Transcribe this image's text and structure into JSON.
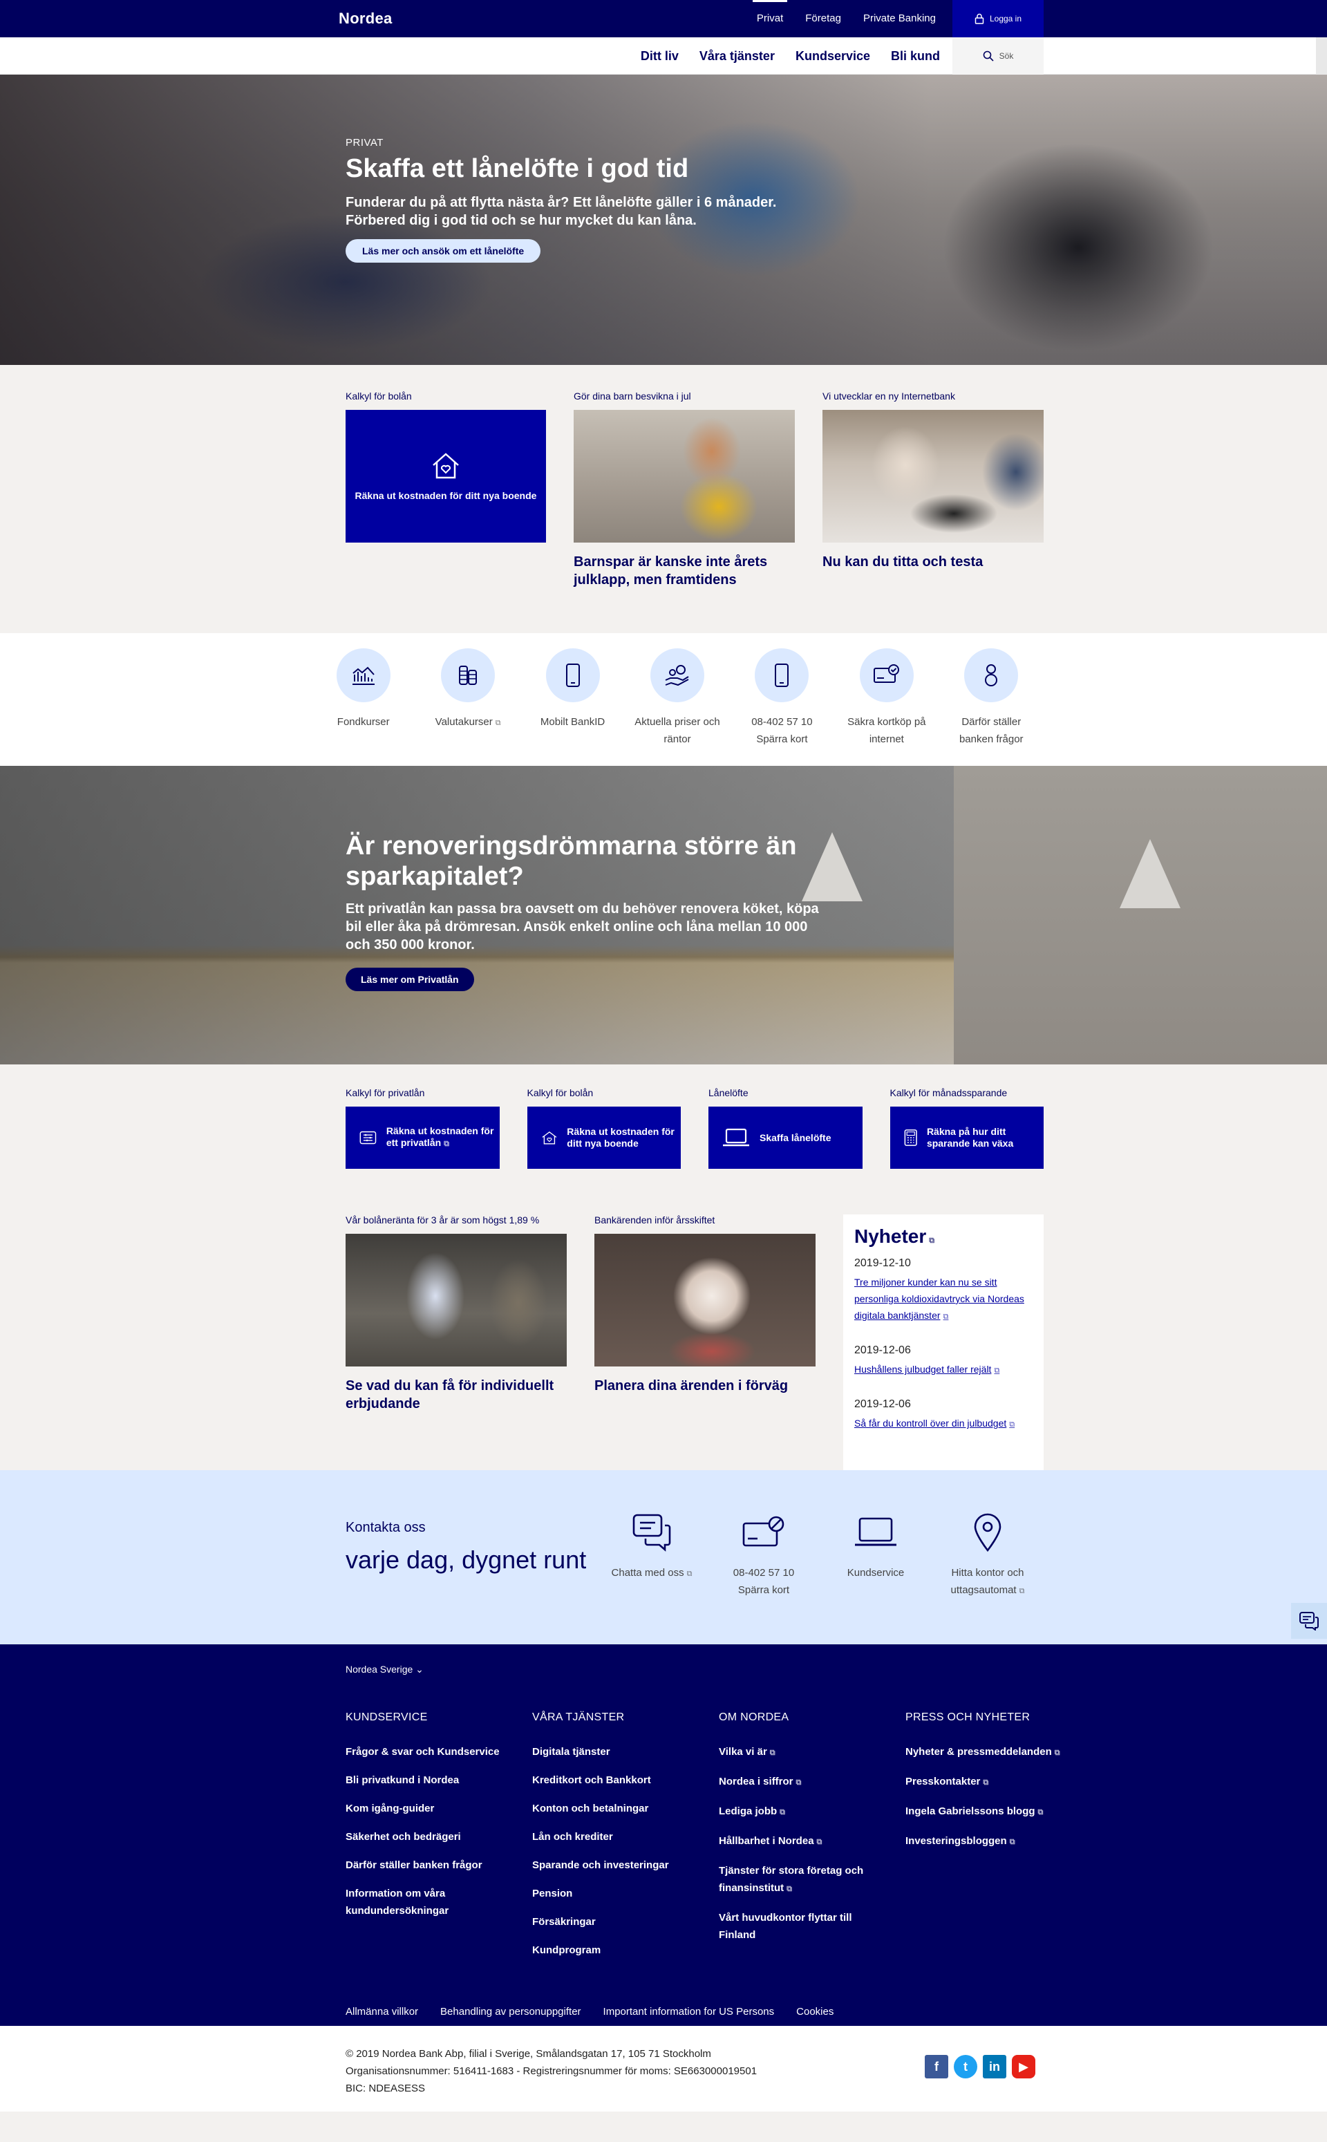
{
  "brand": "Nordea",
  "topnav": [
    "Privat",
    "Företag",
    "Private Banking"
  ],
  "login_label": "Logga in",
  "subnav": [
    "Ditt liv",
    "Våra tjänster",
    "Kundservice",
    "Bli kund"
  ],
  "search_label": "Sök",
  "hero": {
    "eyebrow": "PRIVAT",
    "title": "Skaffa ett lånelöfte i god tid",
    "text": "Funderar du på att flytta nästa år? Ett lånelöfte gäller i 6 månader. Förbered dig i god tid och se hur mycket du kan låna.",
    "button": "Läs mer och ansök om ett lånelöfte"
  },
  "cards": [
    {
      "label": "Kalkyl för bolån",
      "box_text": "Räkna ut kostnaden för ditt nya boende",
      "title": ""
    },
    {
      "label": "Gör dina barn besvikna i jul",
      "title": "Barnspar är kanske inte årets julklapp, men framtidens"
    },
    {
      "label": "Vi utvecklar en ny Internetbank",
      "title": "Nu kan du titta och testa"
    }
  ],
  "quicklinks": [
    {
      "label": "Fondkurser",
      "icon": "chart-icon"
    },
    {
      "label": "Valutakurser",
      "icon": "coins-icon"
    },
    {
      "label": "Mobilt BankID",
      "icon": "mobile-icon"
    },
    {
      "label": "Aktuella priser och räntor",
      "icon": "hand-coins-icon"
    },
    {
      "label": "08-402 57 10 Spärra kort",
      "icon": "phone-icon"
    },
    {
      "label": "Säkra kortköp på internet",
      "icon": "card-check-icon"
    },
    {
      "label": "Därför ställer banken frågor",
      "icon": "person-icon"
    }
  ],
  "reno": {
    "title": "Är renoveringsdrömmarna större än sparkapitalet?",
    "text": "Ett privatlån kan passa bra oavsett om du behöver renovera köket, köpa bil eller åka på drömresan. Ansök enkelt online och låna mellan 10 000 och 350 000 kronor.",
    "button": "Läs mer om Privatlån"
  },
  "calcs": [
    {
      "label": "Kalkyl för privatlån",
      "text": "Räkna ut kostnaden för ett privatlån"
    },
    {
      "label": "Kalkyl för bolån",
      "text": "Räkna ut kostnaden för ditt nya boende"
    },
    {
      "label": "Lånelöfte",
      "text": "Skaffa lånelöfte"
    },
    {
      "label": "Kalkyl för månadssparande",
      "text": "Räkna på hur ditt sparande kan växa"
    }
  ],
  "promos": [
    {
      "label": "Vår bolåneränta för 3 år är som högst 1,89 %",
      "title": "Se vad du kan få för individuellt erbjudande"
    },
    {
      "label": "Bankärenden inför årsskiftet",
      "title": "Planera dina ärenden i förväg"
    }
  ],
  "news": {
    "title": "Nyheter",
    "items": [
      {
        "date": "2019-12-10",
        "text": "Tre miljoner kunder kan nu se sitt personliga koldioxidavtryck via Nordeas digitala banktjänster"
      },
      {
        "date": "2019-12-06",
        "text": "Hushållens julbudget faller rejält"
      },
      {
        "date": "2019-12-06",
        "text": "Så får du kontroll över din julbudget"
      }
    ]
  },
  "contact": {
    "small": "Kontakta oss",
    "big": "varje dag, dygnet runt",
    "items": [
      {
        "label": "Chatta med oss",
        "icon": "chat-icon"
      },
      {
        "label": "08-402 57 10 Spärra kort",
        "icon": "card-block-icon"
      },
      {
        "label": "Kundservice",
        "icon": "laptop-icon"
      },
      {
        "label": "Hitta kontor och uttagsautomat",
        "icon": "location-pin-icon"
      }
    ]
  },
  "footer": {
    "region": "Nordea Sverige",
    "cols": [
      {
        "title": "KUNDSERVICE",
        "links": [
          "Frågor & svar och Kundservice",
          "Bli privatkund i Nordea",
          "Kom igång-guider",
          "Säkerhet och bedrägeri",
          "Därför ställer banken frågor",
          "Information om våra kundundersökningar"
        ]
      },
      {
        "title": "VÅRA TJÄNSTER",
        "links": [
          "Digitala tjänster",
          "Kreditkort och Bankkort",
          "Konton och betalningar",
          "Lån och krediter",
          "Sparande och investeringar",
          "Pension",
          "Försäkringar",
          "Kundprogram"
        ]
      },
      {
        "title": "OM NORDEA",
        "links": [
          "Vilka vi är",
          "Nordea i siffror",
          "Lediga jobb",
          "Hållbarhet i Nordea",
          "Tjänster för stora företag och finansinstitut",
          "Vårt huvudkontor flyttar till Finland"
        ]
      },
      {
        "title": "PRESS OCH NYHETER",
        "links": [
          "Nyheter & pressmeddelanden",
          "Presskontakter",
          "Ingela Gabrielssons blogg",
          "Investeringsbloggen"
        ]
      }
    ],
    "legal": [
      "Allmänna villkor",
      "Behandling av personuppgifter",
      "Important information for US Persons",
      "Cookies"
    ]
  },
  "copyright": {
    "line1": "© 2019 Nordea Bank Abp, filial i Sverige, Smålandsgatan 17, 105 71 Stockholm",
    "line2": "Organisationsnummer: 516411-1683 - Registreringsnummer för moms: SE663000019501",
    "line3": "BIC: NDEASESS"
  },
  "colors": {
    "navy": "#00005e",
    "blue": "#0000a0",
    "light": "#dbe9ff"
  }
}
